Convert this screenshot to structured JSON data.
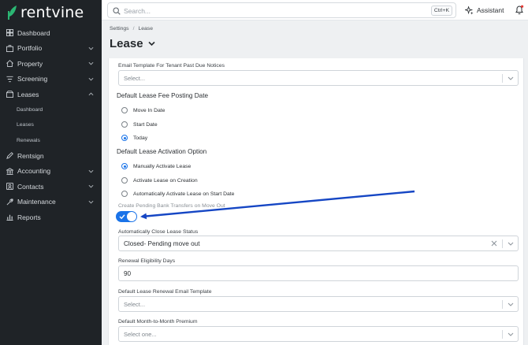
{
  "app": {
    "brand": "rentvine"
  },
  "sidebar": {
    "items": [
      {
        "label": "Dashboard",
        "icon": "dashboard-icon"
      },
      {
        "label": "Portfolio",
        "icon": "portfolio-icon",
        "has_chevron": true
      },
      {
        "label": "Property",
        "icon": "property-icon",
        "has_chevron": true
      },
      {
        "label": "Screening",
        "icon": "screening-icon",
        "has_chevron": true
      },
      {
        "label": "Leases",
        "icon": "leases-icon",
        "has_chevron": true,
        "expanded": true
      },
      {
        "label": "Rentsign",
        "icon": "rentsign-icon"
      },
      {
        "label": "Accounting",
        "icon": "accounting-icon",
        "has_chevron": true
      },
      {
        "label": "Contacts",
        "icon": "contacts-icon",
        "has_chevron": true
      },
      {
        "label": "Maintenance",
        "icon": "maintenance-icon",
        "has_chevron": true
      },
      {
        "label": "Reports",
        "icon": "reports-icon"
      }
    ],
    "lease_subitems": [
      "Dashboard",
      "Leases",
      "Renewals"
    ]
  },
  "header": {
    "search_placeholder": "Search...",
    "shortcut": "Ctrl+K",
    "assistant_label": "Assistant"
  },
  "breadcrumb": {
    "root": "Settings",
    "separator": "/",
    "current": "Lease"
  },
  "page_title": "Lease",
  "form": {
    "past_due_template": {
      "label": "Email Template For Tenant Past Due Notices",
      "placeholder": "Select..."
    },
    "fee_posting": {
      "title": "Default Lease Fee Posting Date",
      "options": [
        "Move In Date",
        "Start Date",
        "Today"
      ],
      "selected": "Today"
    },
    "activation": {
      "title": "Default Lease Activation Option",
      "options": [
        "Manually Activate Lease",
        "Activate Lease on Creation",
        "Automatically Activate Lease on Start Date"
      ],
      "selected": "Manually Activate Lease"
    },
    "pending_transfers": {
      "label": "Create Pending Bank Transfers on Move Out",
      "enabled": true
    },
    "auto_close_status": {
      "label": "Automatically Close Lease Status",
      "value": "Closed- Pending move out"
    },
    "renewal_days": {
      "label": "Renewal Eligibility Days",
      "value": "90"
    },
    "renewal_email": {
      "label": "Default Lease Renewal Email Template",
      "placeholder": "Select..."
    },
    "mtm_premium": {
      "label": "Default Month-to-Month Premium",
      "placeholder": "Select one..."
    }
  },
  "colors": {
    "sidebar_bg": "#1f2327",
    "accent": "#1a73e8",
    "arrow": "#1546c4",
    "logo_green": "#2bb673"
  }
}
